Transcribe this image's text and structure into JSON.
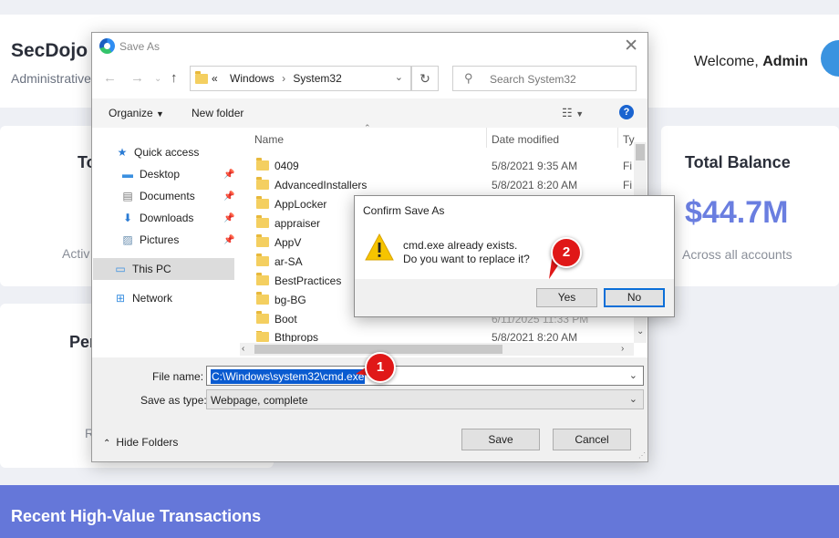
{
  "site": {
    "brand_title": "SecDojo",
    "brand_subtitle": "Administrative",
    "welcome_prefix": "Welcome,",
    "welcome_user": "Admin",
    "card_left_title": "To",
    "card_left_sub": "Activ",
    "card_right_title": "Total Balance",
    "card_right_value": "$44.7M",
    "card_right_sub": "Across all accounts",
    "card_left2_title": "Per",
    "card_left2_sub": "R",
    "banner_title": "Recent High-Value Transactions"
  },
  "save_dialog": {
    "title": "Save As",
    "address": {
      "overflow": "«",
      "segments": [
        "Windows",
        "System32"
      ]
    },
    "search_placeholder": "Search System32",
    "toolbar": {
      "organize": "Organize",
      "new_folder": "New folder"
    },
    "help": "?",
    "nav": [
      {
        "label": "Quick access",
        "icon": "star-icon"
      },
      {
        "label": "Desktop",
        "icon": "desktop-icon",
        "pinned": true
      },
      {
        "label": "Documents",
        "icon": "documents-icon",
        "pinned": true
      },
      {
        "label": "Downloads",
        "icon": "download-icon",
        "pinned": true
      },
      {
        "label": "Pictures",
        "icon": "pictures-icon",
        "pinned": true
      },
      {
        "label": "This PC",
        "icon": "computer-icon",
        "selected": true
      },
      {
        "label": "Network",
        "icon": "network-icon"
      }
    ],
    "columns": {
      "name": "Name",
      "date": "Date modified",
      "type": "Ty"
    },
    "files": [
      {
        "name": "0409",
        "date": "5/8/2021 9:35 AM",
        "type": "Fi"
      },
      {
        "name": "AdvancedInstallers",
        "date": "5/8/2021 8:20 AM",
        "type": "Fi"
      },
      {
        "name": "AppLocker",
        "date": "",
        "type": ""
      },
      {
        "name": "appraiser",
        "date": "",
        "type": ""
      },
      {
        "name": "AppV",
        "date": "",
        "type": ""
      },
      {
        "name": "ar-SA",
        "date": "",
        "type": ""
      },
      {
        "name": "BestPractices",
        "date": "",
        "type": ""
      },
      {
        "name": "bg-BG",
        "date": "",
        "type": ""
      },
      {
        "name": "Boot",
        "date": "6/11/2025 11:33 PM",
        "type": ""
      },
      {
        "name": "Bthprops",
        "date": "5/8/2021 8:20 AM",
        "type": ""
      }
    ],
    "file_name_label": "File name:",
    "file_name_value": "C:\\Windows\\system32\\cmd.exe",
    "save_as_type_label": "Save as type:",
    "save_as_type_value": "Webpage, complete",
    "hide_folders": "Hide Folders",
    "save_button": "Save",
    "cancel_button": "Cancel"
  },
  "confirm_dialog": {
    "title": "Confirm Save As",
    "message_line1": "cmd.exe already exists.",
    "message_line2": "Do you want to replace it?",
    "yes_button": "Yes",
    "no_button": "No"
  },
  "annotations": {
    "step1": "1",
    "step2": "2"
  },
  "colors": {
    "accent": "#6577d9",
    "balance": "#6a7ee0",
    "badge": "#e01818",
    "selection": "#0a5bd0"
  }
}
